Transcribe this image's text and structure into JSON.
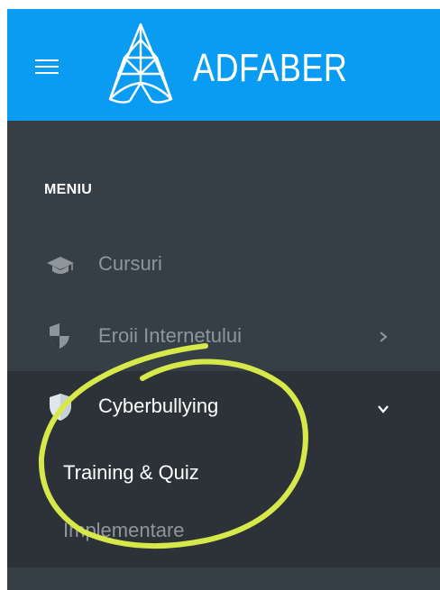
{
  "brand": {
    "name": "ADFABER"
  },
  "header_icons": {
    "menu": "hamburger-icon",
    "logo": "adfaber-logo"
  },
  "menu": {
    "header": "MENIU",
    "items": [
      {
        "label": "Cursuri",
        "icon": "graduation-cap-icon",
        "state": "inactive"
      },
      {
        "label": "Eroii Internetului",
        "icon": "shield-icon",
        "chevron": "chevron-right-icon",
        "state": "inactive"
      },
      {
        "label": "Cyberbullying",
        "icon": "shield-icon",
        "chevron": "chevron-down-icon",
        "state": "expanded",
        "children": [
          {
            "label": "Training & Quiz",
            "state": "highlighted"
          },
          {
            "label": "Implementare",
            "state": "inactive"
          }
        ]
      }
    ]
  },
  "colors": {
    "topbar": "#0a9cf3",
    "sidebar": "#373f46",
    "expanded_group": "#2c3238",
    "annotation_circle": "#d7e84a",
    "dim_text": "#8e969c"
  }
}
